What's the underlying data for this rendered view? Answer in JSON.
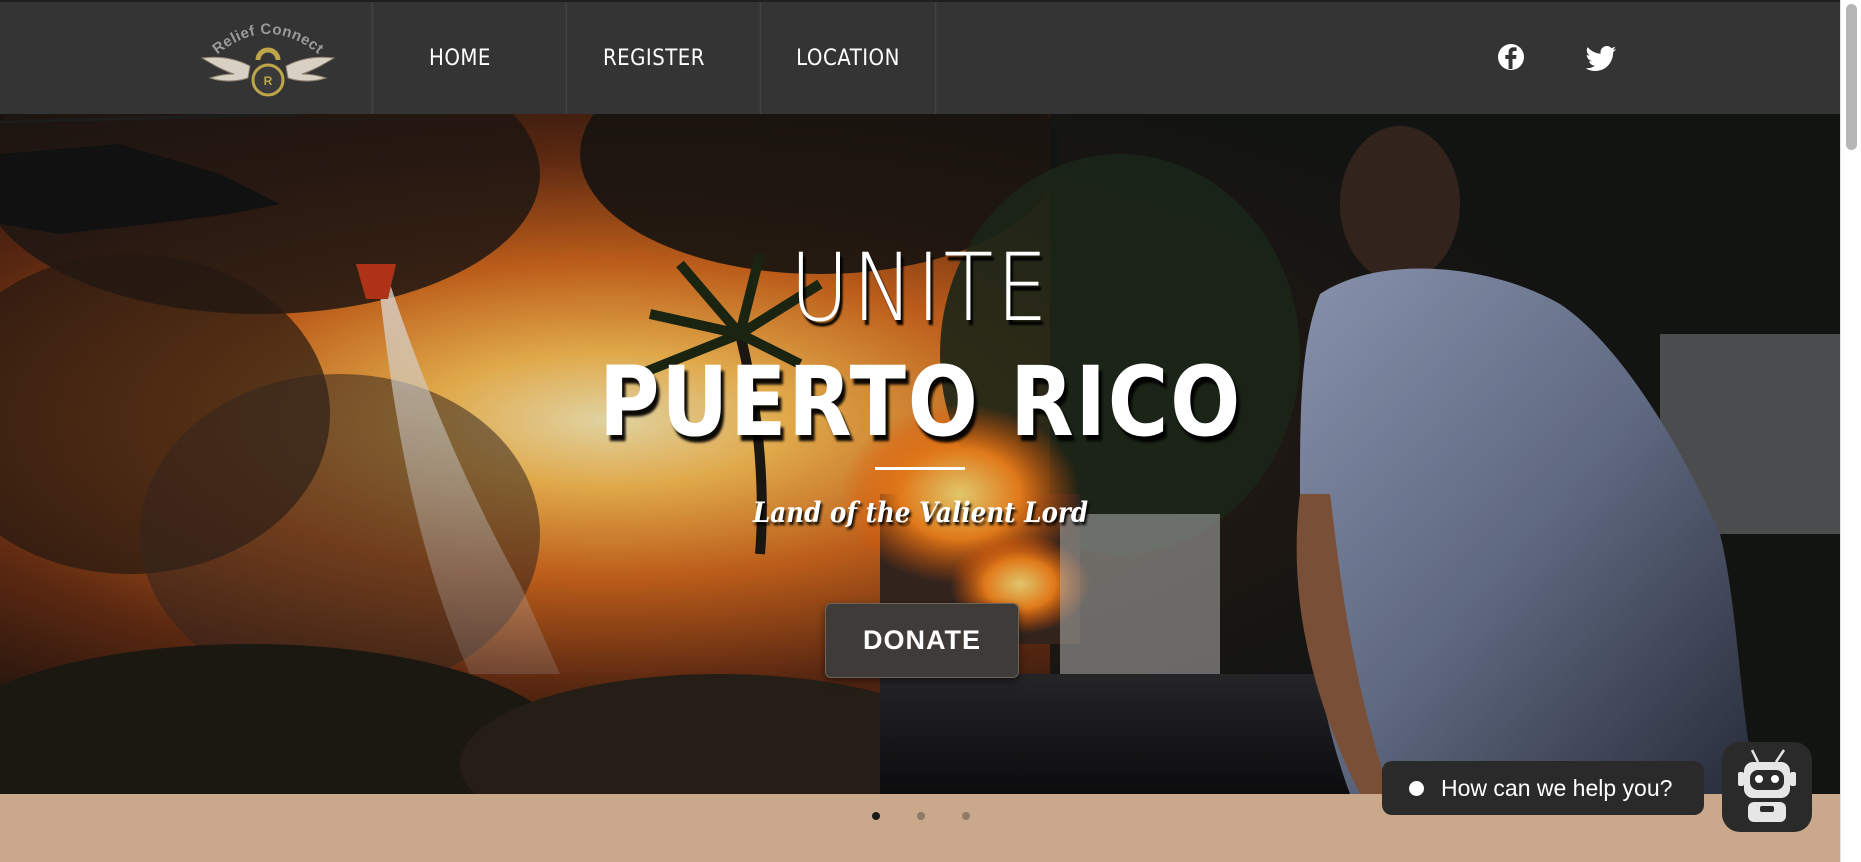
{
  "nav": {
    "logo_text": "Relief Connect",
    "items": [
      {
        "label": "HOME"
      },
      {
        "label": "REGISTER"
      },
      {
        "label": "LOCATION"
      }
    ],
    "social": [
      "facebook-icon",
      "twitter-icon"
    ]
  },
  "hero": {
    "headline_small": "UNITE",
    "headline_big": "PUERTO RICO",
    "tagline": "Land of the Valient Lord",
    "cta_label": "DONATE",
    "slide_count": 3,
    "active_slide": 1
  },
  "chat": {
    "prompt": "How can we help you?"
  },
  "colors": {
    "nav_bg": "#343434",
    "page_bg": "#c9a88c",
    "button_bg": "#3f3b38",
    "chat_bg": "#2a2a2a"
  }
}
